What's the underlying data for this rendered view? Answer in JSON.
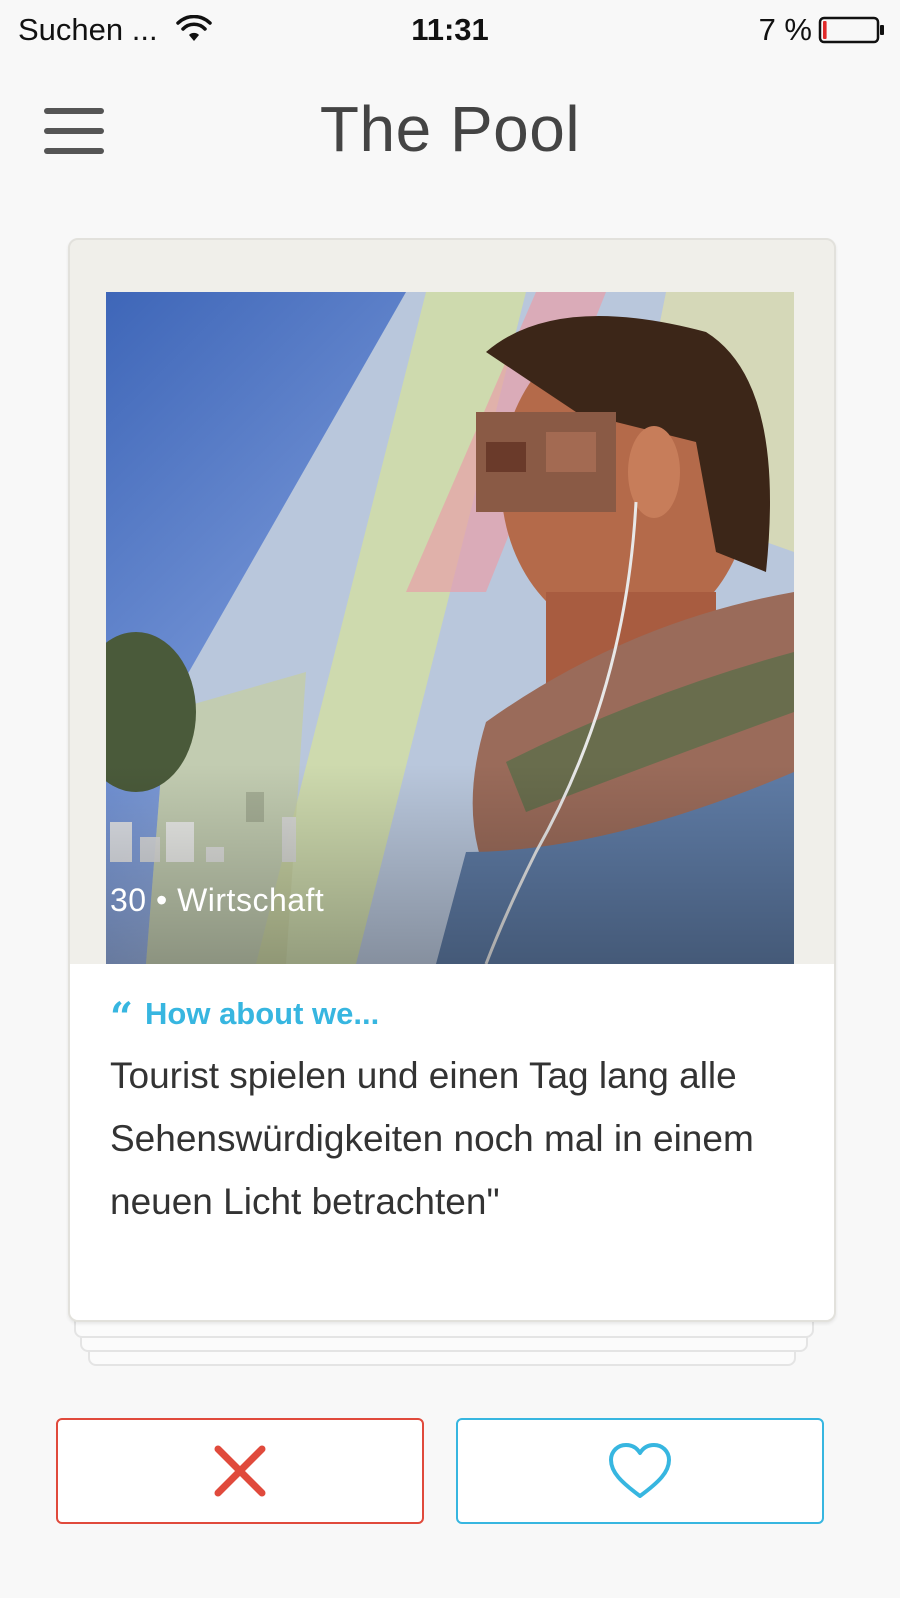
{
  "status_bar": {
    "carrier": "Suchen ...",
    "time": "11:31",
    "battery_percent": "7 %",
    "battery_level": 0.07
  },
  "header": {
    "title": "The Pool"
  },
  "profile": {
    "meta": "30 • Wirtschaft",
    "prompt_heading": "How about we...",
    "prompt_text": "Tourist spielen und einen Tag lang alle Sehenswürdigkeiten noch mal in einem neuen Licht betrachten\""
  },
  "icons": {
    "menu": "hamburger-menu-icon",
    "wifi": "wifi-icon",
    "battery": "battery-icon",
    "quote": "quote-icon",
    "dislike": "close-x-icon",
    "like": "heart-outline-icon"
  },
  "colors": {
    "accent_blue": "#37b6e0",
    "dislike_red": "#e04a3c",
    "battery_low": "#e02a2a"
  }
}
